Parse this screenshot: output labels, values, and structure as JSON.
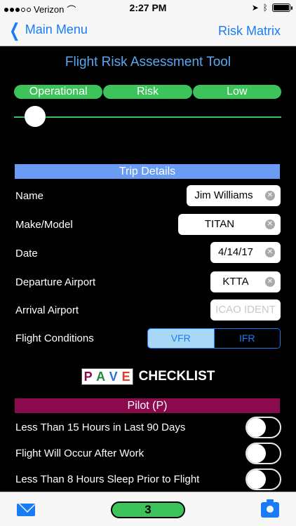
{
  "status": {
    "carrier": "Verizon",
    "time": "2:27 PM"
  },
  "nav": {
    "back_label": "Main Menu",
    "right_label": "Risk Matrix"
  },
  "title": "Flight Risk Assessment Tool",
  "risk_level": {
    "segments": [
      "Operational",
      "Risk",
      "Low"
    ],
    "slider_value": 0.08,
    "color": "#3cc35a"
  },
  "trip": {
    "header": "Trip Details",
    "fields": {
      "name": {
        "label": "Name",
        "value": "Jim Williams"
      },
      "make_model": {
        "label": "Make/Model",
        "value": "TITAN"
      },
      "date": {
        "label": "Date",
        "value": "4/14/17"
      },
      "departure": {
        "label": "Departure Airport",
        "value": "KTTA"
      },
      "arrival": {
        "label": "Arrival Airport",
        "placeholder": "ICAO IDENT"
      },
      "conditions": {
        "label": "Flight Conditions",
        "options": [
          "VFR",
          "IFR"
        ],
        "selected": "VFR"
      }
    }
  },
  "pave": {
    "letters": [
      "P",
      "A",
      "V",
      "E"
    ],
    "letter_colors": [
      "#8b0a4e",
      "#1d8a3a",
      "#2d6fd6",
      "#e03b2a"
    ],
    "word": "CHECKLIST"
  },
  "pilot": {
    "header": "Pilot (P)",
    "items": [
      {
        "label": "Less Than 15 Hours in Last 90 Days",
        "on": false
      },
      {
        "label": "Flight Will Occur After Work",
        "on": false
      },
      {
        "label": "Less Than 8 Hours Sleep Prior to Flight",
        "on": false
      }
    ]
  },
  "toolbar": {
    "score": "3",
    "icons": [
      "mail-icon",
      "camera-icon"
    ]
  }
}
